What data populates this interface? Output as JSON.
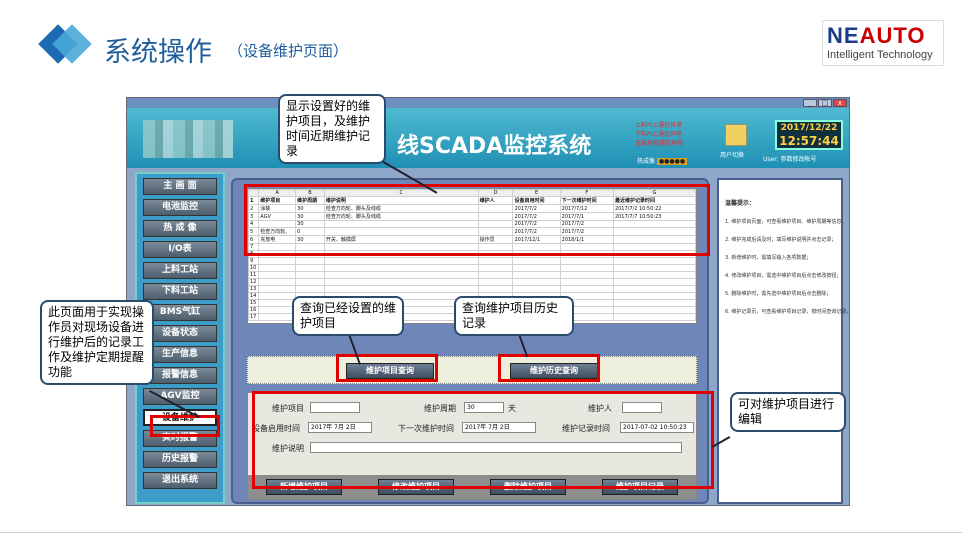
{
  "slide": {
    "title": "系统操作",
    "subtitle": "（设备维护页面）",
    "logo_main_ne": "NE",
    "logo_main_auto": "AUTO",
    "logo_sub": "Intelligent Technology"
  },
  "app": {
    "system_title": "线SCADA监控系统",
    "alarms": [
      "上料PLC通信异常",
      "下料PLC通信异常",
      "无损电阻通信异常"
    ],
    "dots_label": "热成像",
    "user_switch": "用户切换",
    "clock_date": "2017/12/22",
    "clock_time": "12:57:44",
    "user_line": "User:  参数修改帐号",
    "menu": [
      "主 画 面",
      "电池监控",
      "热 成 像",
      "I/O表",
      "上料工站",
      "下料工站",
      "BMS气缸",
      "设备状态",
      "生产信息",
      "报警信息",
      "AGV监控",
      "设备维护",
      "实时报警",
      "历史报警",
      "退出系统"
    ],
    "active_menu_index": 11,
    "grid": {
      "col_letters": [
        "",
        "A",
        "B",
        "C",
        "D",
        "E",
        "F",
        "G"
      ],
      "headers": [
        "1",
        "维护项目",
        "维护周期",
        "维护说明",
        "维护人",
        "设备启用时间",
        "下一次维护时间",
        "最近维护记录时间"
      ],
      "rows": [
        [
          "2",
          "涂装",
          "30",
          "检查万向轮、脚头及线缆",
          "",
          "2017/7/2",
          "2017/7/12",
          "2017/7/2 10:50:22"
        ],
        [
          "3",
          "AGV",
          "30",
          "检查万向轮、脚头及线缆",
          "",
          "2017/7/2",
          "2017/7/1",
          "2017/7/7 10:50:23"
        ],
        [
          "4",
          "",
          "30",
          "",
          "",
          "2017/7/2",
          "2017/7/2",
          ""
        ],
        [
          "5",
          "检查万向轮、",
          "0",
          "",
          "",
          "2017/7/2",
          "2017/7/2",
          ""
        ],
        [
          "6",
          "充放电",
          "30",
          "开关、触摸屏",
          "操作员",
          "2017/12/1",
          "2018/1/1",
          ""
        ],
        [
          "7",
          "",
          "",
          "",
          "",
          "",
          "",
          ""
        ],
        [
          "8",
          "",
          "",
          "",
          "",
          "",
          "",
          ""
        ],
        [
          "9",
          "",
          "",
          "",
          "",
          "",
          "",
          ""
        ],
        [
          "10",
          "",
          "",
          "",
          "",
          "",
          "",
          ""
        ],
        [
          "11",
          "",
          "",
          "",
          "",
          "",
          "",
          ""
        ],
        [
          "12",
          "",
          "",
          "",
          "",
          "",
          "",
          ""
        ],
        [
          "13",
          "",
          "",
          "",
          "",
          "",
          "",
          ""
        ],
        [
          "14",
          "",
          "",
          "",
          "",
          "",
          "",
          ""
        ],
        [
          "15",
          "",
          "",
          "",
          "",
          "",
          "",
          ""
        ],
        [
          "16",
          "",
          "",
          "",
          "",
          "",
          "",
          ""
        ],
        [
          "17",
          "",
          "",
          "",
          "",
          "",
          "",
          ""
        ]
      ]
    },
    "buttons": {
      "query_items": "维护项目查询",
      "query_history": "维护历史查询",
      "add_item": "新增维护项目",
      "edit_item": "修改维护项目",
      "delete_item": "删除维护项目",
      "item_record": "维护项目记录"
    },
    "form": {
      "item_label": "维护项目",
      "item_value": "",
      "cycle_label": "维护周期",
      "cycle_value": "30",
      "cycle_unit": "天",
      "person_label": "维护人",
      "person_value": "",
      "start_label": "设备启用时间",
      "start_value": "2017年 7月 2日",
      "next_label": "下一次维护时间",
      "next_value": "2017年 7月 2日",
      "record_label": "维护记录时间",
      "record_value": "2017-07-02 10:50:23",
      "desc_label": "维护说明",
      "desc_value": ""
    },
    "tips_title": "温馨提示：",
    "tips": [
      "1. 维护项目页面，可查看维护项目、维护周期等信息；",
      "2. 维护完成后请及时，填写维护说明并点击记录；",
      "3. 新增维护时，需填写输入各项数据；",
      "4. 修改维护项目，需选中维护项目后点击修改按钮；",
      "5. 删除维护时，需先选中维护项目后点击删除；",
      "6. 维护记录页，可查看维护项目记录，按时间查询记录。"
    ]
  },
  "annotations": {
    "grid_note": "显示设置好的维护项目，及维护时间近期维护记录",
    "page_note": "此页面用于实现操作员对现场设备进行维护后的记录工作及维护定期提醒功能",
    "query_note": "查询已经设置的维护项目",
    "history_note": "查询维护项目历史记录",
    "edit_note": "可对维护项目进行编辑"
  }
}
